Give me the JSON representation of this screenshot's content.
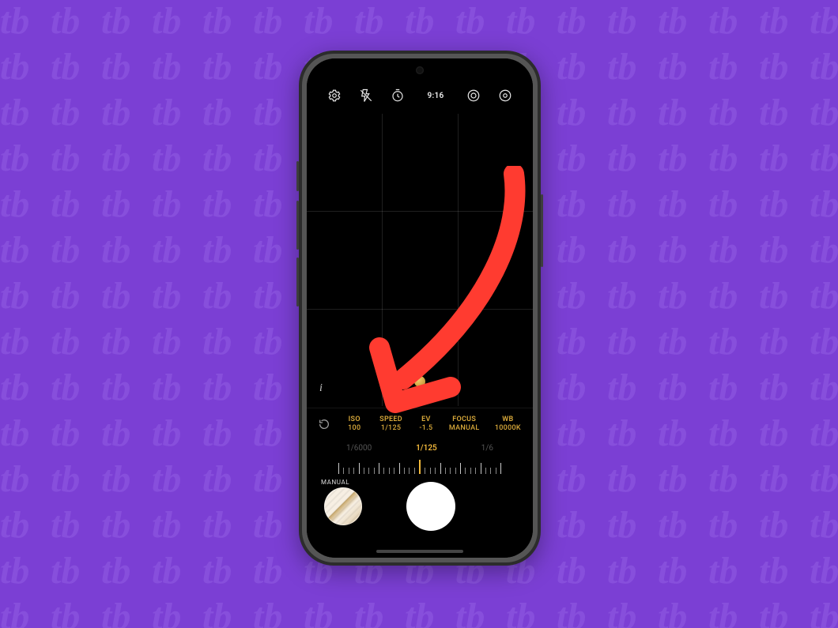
{
  "background": {
    "color": "#7b3fd4",
    "pattern_text": "tb"
  },
  "top_icons": {
    "settings": "gear-icon",
    "flash": "flash-off-icon",
    "timer": "timer-icon",
    "ratio": "9:16",
    "metering": "metering-icon",
    "more": "circle-settings-icon"
  },
  "viewfinder": {
    "info_button": "i",
    "grid": "3x3"
  },
  "params": {
    "reset": "↺",
    "items": [
      {
        "label": "ISO",
        "value": "100"
      },
      {
        "label": "SPEED",
        "value": "1/125"
      },
      {
        "label": "EV",
        "value": "-1.5"
      },
      {
        "label": "FOCUS",
        "value": "MANUAL"
      },
      {
        "label": "WB",
        "value": "10000K"
      }
    ]
  },
  "slider": {
    "left_label": "1/6000",
    "center_label": "1/125",
    "right_label": "1/6",
    "mode_label": "MANUAL"
  },
  "bottom": {
    "gallery_thumb": "last-photo",
    "shutter": "shutter"
  },
  "annotation": {
    "arrow_color": "#ff3b30",
    "target": "params.items.1"
  }
}
